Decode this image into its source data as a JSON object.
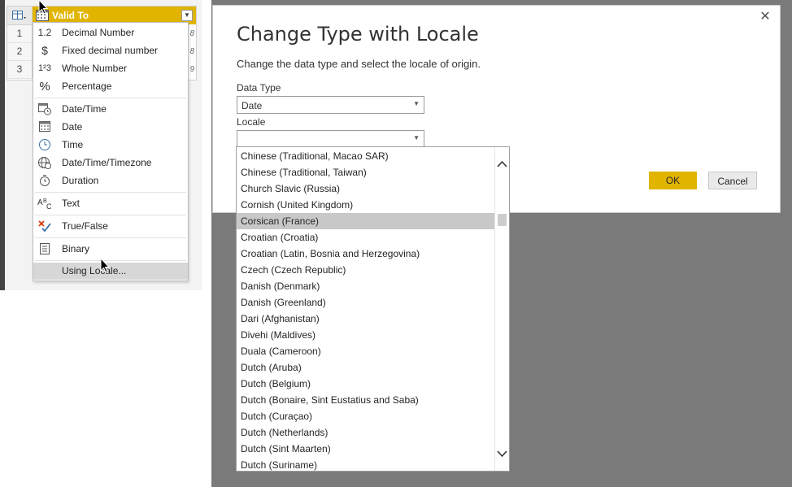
{
  "grid": {
    "column_title": "Valid To",
    "rows": [
      {
        "num": "1",
        "cell": "8"
      },
      {
        "num": "2",
        "cell": "8"
      },
      {
        "num": "3",
        "cell": "9"
      }
    ]
  },
  "type_menu": {
    "items": [
      {
        "icon": "1.2",
        "icon_name": "decimal-icon",
        "label": "Decimal Number"
      },
      {
        "icon": "$",
        "icon_name": "dollar-icon",
        "label": "Fixed decimal number"
      },
      {
        "icon": "1²3",
        "icon_name": "whole-number-icon",
        "label": "Whole Number"
      },
      {
        "icon": "%",
        "icon_name": "percent-icon",
        "label": "Percentage"
      },
      {
        "icon": "",
        "icon_name": "datetime-icon",
        "label": "Date/Time"
      },
      {
        "icon": "",
        "icon_name": "calendar-icon",
        "label": "Date"
      },
      {
        "icon": "",
        "icon_name": "clock-icon",
        "label": "Time"
      },
      {
        "icon": "",
        "icon_name": "globe-clock-icon",
        "label": "Date/Time/Timezone"
      },
      {
        "icon": "",
        "icon_name": "stopwatch-icon",
        "label": "Duration"
      },
      {
        "icon": "ABC",
        "icon_name": "text-icon",
        "label": "Text"
      },
      {
        "icon": "",
        "icon_name": "true-false-icon",
        "label": "True/False"
      },
      {
        "icon": "",
        "icon_name": "binary-icon",
        "label": "Binary"
      },
      {
        "icon": "",
        "icon_name": "",
        "label": "Using Locale..."
      }
    ]
  },
  "dialog": {
    "title": "Change Type with Locale",
    "description": "Change the data type and select the locale of origin.",
    "data_type_label": "Data Type",
    "data_type_value": "Date",
    "locale_label": "Locale",
    "locale_value": "",
    "ok_label": "OK",
    "cancel_label": "Cancel",
    "close_glyph": "✕"
  },
  "locale_options": [
    "Chinese (Traditional, Macao SAR)",
    "Chinese (Traditional, Taiwan)",
    "Church Slavic (Russia)",
    "Cornish (United Kingdom)",
    "Corsican (France)",
    "Croatian (Croatia)",
    "Croatian (Latin, Bosnia and Herzegovina)",
    "Czech (Czech Republic)",
    "Danish (Denmark)",
    "Danish (Greenland)",
    "Dari (Afghanistan)",
    "Divehi (Maldives)",
    "Duala (Cameroon)",
    "Dutch (Aruba)",
    "Dutch (Belgium)",
    "Dutch (Bonaire, Sint Eustatius and Saba)",
    "Dutch (Curaçao)",
    "Dutch (Netherlands)",
    "Dutch (Sint Maarten)",
    "Dutch (Suriname)"
  ],
  "selected_locale_index": 4,
  "colors": {
    "accent": "#e1b400",
    "highlight": "#c8c8c8",
    "backdrop": "#7a7a7a"
  }
}
